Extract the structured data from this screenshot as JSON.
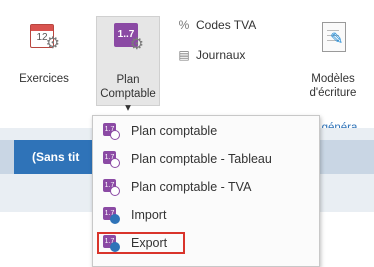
{
  "ribbon": {
    "exercices": {
      "label": "Exercices",
      "calendar_text": "12",
      "icon": "calendar-gear-icon"
    },
    "plan": {
      "line1": "Plan",
      "line2": "Comptable",
      "caret": "▾",
      "icon_text": "1..7",
      "icon": "plan-comptable-gear-icon"
    },
    "codes_tva": {
      "label": "Codes TVA",
      "icon": "percent-gear-icon"
    },
    "journaux": {
      "label": "Journaux",
      "icon": "journal-gear-icon"
    },
    "modeles": {
      "line1": "Modèles",
      "line2": "d'écriture",
      "icon": "document-pen-icon"
    }
  },
  "tabs": {
    "active": "(Sans tit"
  },
  "side_link": "é généra",
  "menu": {
    "items": [
      {
        "label": "Plan comptable",
        "icon": "plan-comptable-icon"
      },
      {
        "label": "Plan comptable - Tableau",
        "icon": "plan-comptable-table-icon"
      },
      {
        "label": "Plan comptable - TVA",
        "icon": "plan-comptable-tva-icon"
      },
      {
        "label": "Import",
        "icon": "import-icon"
      },
      {
        "label": "Export",
        "icon": "export-icon",
        "highlighted": true
      }
    ]
  },
  "colors": {
    "accent": "#2f73b8",
    "brand_purple": "#8b4aa4",
    "highlight_red": "#d9342b"
  }
}
